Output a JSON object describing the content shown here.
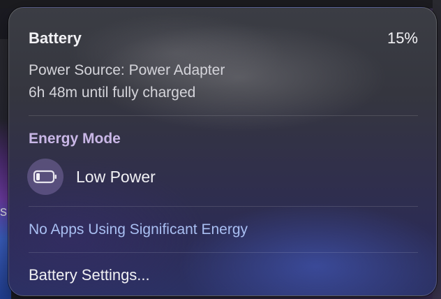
{
  "battery": {
    "title": "Battery",
    "percent": "15%",
    "power_source": "Power Source: Power Adapter",
    "charge_time": "6h 48m until fully charged"
  },
  "energy_mode": {
    "section_title": "Energy Mode",
    "mode_label": "Low Power",
    "icon": "battery-low-icon"
  },
  "apps": {
    "status_text": "No Apps Using Significant Energy"
  },
  "footer": {
    "settings_label": "Battery Settings..."
  },
  "background": {
    "edge_char": "s"
  },
  "colors": {
    "section_title": "#c9b7e6",
    "energy_status": "#a9bff2",
    "icon_bg": "#7869a0"
  }
}
